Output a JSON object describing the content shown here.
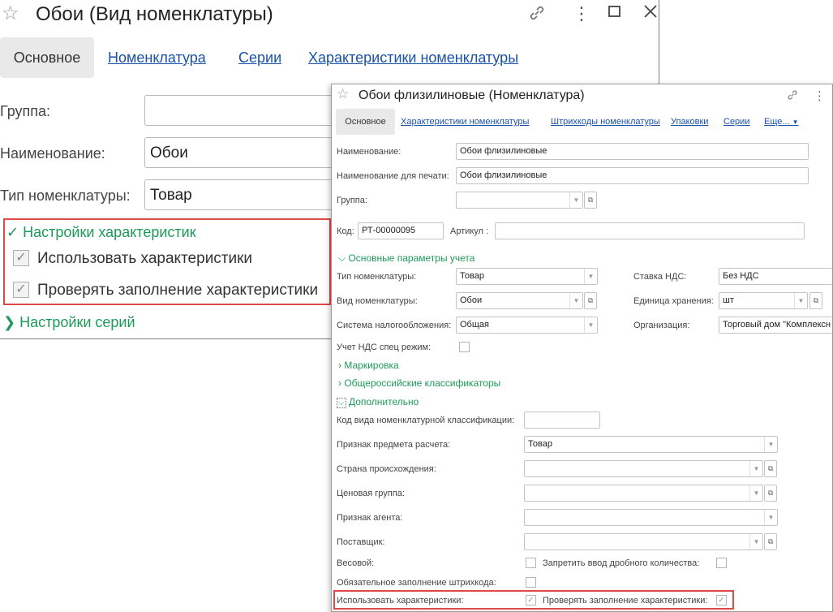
{
  "win1": {
    "title": "Обои (Вид номенклатуры)",
    "star_icon": "☆",
    "toolbar": {
      "link_icon": "🔗",
      "more_icon": "⋮",
      "maximize_icon": "☐",
      "close_icon": "✕"
    },
    "tabs": [
      {
        "label": "Основное",
        "active": true
      },
      {
        "label": "Номенклатура"
      },
      {
        "label": "Серии"
      },
      {
        "label": "Характеристики номенклатуры"
      }
    ],
    "fields": {
      "group_label": "Группа:",
      "group_value": "",
      "name_label": "Наименование:",
      "name_value": "Обои",
      "type_label": "Тип номенклатуры:",
      "type_value": "Товар"
    },
    "char_settings": {
      "header": "Настройки характеристик",
      "use_chars": "Использовать характеристики",
      "check_chars": "Проверять заполнение характеристики"
    },
    "series_settings": {
      "header": "Настройки серий"
    }
  },
  "win2": {
    "title": "Обои флизилиновые (Номенклатура)",
    "star_icon": "☆",
    "toolbar": {
      "link_icon": "🔗",
      "more_icon": "⋮"
    },
    "tabs": {
      "main": "Основное",
      "chars": "Характеристики номенклатуры",
      "barcodes": "Штрихкоды номенклатуры",
      "packages": "Упаковки",
      "series": "Серии",
      "more": "Еще..."
    },
    "name_label": "Наименование:",
    "name_value": "Обои флизилиновые",
    "print_name_label": "Наименование для печати:",
    "print_name_value": "Обои флизилиновые",
    "group_label": "Группа:",
    "code_label": "Код:",
    "code_value": "РТ-00000095",
    "article_label": "Артикул :",
    "main_params_header": "Основные параметры учета",
    "type_label": "Тип номенклатуры:",
    "type_value": "Товар",
    "vat_label": "Ставка НДС:",
    "vat_value": "Без НДС",
    "kind_label": "Вид номенклатуры:",
    "kind_value": "Обои",
    "unit_label": "Единица хранения:",
    "unit_value": "шт",
    "tax_label": "Система налогообложения:",
    "tax_value": "Общая",
    "org_label": "Организация:",
    "org_value": "Торговый дом \"Комплексн",
    "vat_special_label": "Учет НДС спец режим:",
    "marking_header": "Маркировка",
    "classifiers_header": "Общероссийские классификаторы",
    "additional_header": "Дополнительно",
    "class_code_label": "Код вида номенклатурной классификации:",
    "subject_label": "Признак предмета расчета:",
    "subject_value": "Товар",
    "country_label": "Страна происхождения:",
    "price_group_label": "Ценовая группа:",
    "agent_label": "Признак агента:",
    "supplier_label": "Поставщик:",
    "weight_label": "Весовой:",
    "no_fraction_label": "Запретить ввод дробного количества:",
    "barcode_required_label": "Обязательное заполнение штрихкода:",
    "use_chars_label": "Использовать характеристики:",
    "check_chars_label": "Проверять заполнение характеристики:"
  }
}
